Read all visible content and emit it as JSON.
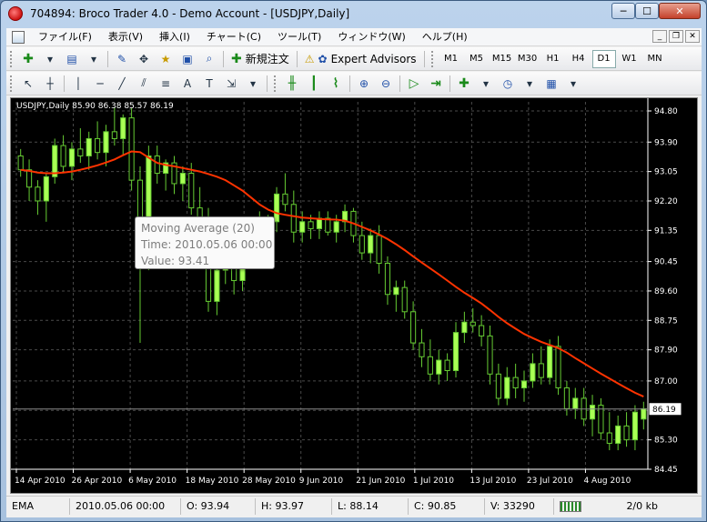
{
  "window": {
    "title": "704894: Broco Trader 4.0 - Demo Account - [USDJPY,Daily]",
    "controls": {
      "minimize": "─",
      "maximize": "☐",
      "close": "✕"
    }
  },
  "menu": [
    "ファイル(F)",
    "表示(V)",
    "挿入(I)",
    "チャート(C)",
    "ツール(T)",
    "ウィンドウ(W)",
    "ヘルプ(H)"
  ],
  "toolbar1": {
    "new_order": "新規注文",
    "expert_advisors": "Expert Advisors",
    "timeframes": [
      "M1",
      "M5",
      "M15",
      "M30",
      "H1",
      "H4",
      "D1",
      "W1",
      "MN"
    ],
    "active_timeframe": "D1"
  },
  "toolbar2": {
    "text_tool": "A",
    "label_tool": "T"
  },
  "chart": {
    "symbol_label": "USDJPY,Daily  85.90 86.38 85.57 86.19",
    "current_price": "86.19",
    "colors": {
      "background": "#000000",
      "grid": "#4a4a4a",
      "bull": "#aaff55",
      "bear": "#000000",
      "wick": "#66cc33",
      "ma": "#ff3300",
      "axis_text": "#ffffff"
    }
  },
  "chart_data": {
    "type": "candlestick",
    "y_ticks": [
      "94.80",
      "93.90",
      "93.05",
      "92.20",
      "91.35",
      "90.45",
      "89.60",
      "88.75",
      "87.90",
      "87.00",
      "86.15",
      "85.30",
      "84.45"
    ],
    "ylim": [
      84.45,
      94.8
    ],
    "x_labels": [
      "14 Apr 2010",
      "26 Apr 2010",
      "6 May 2010",
      "18 May 2010",
      "28 May 2010",
      "9 Jun 2010",
      "21 Jun 2010",
      "1 Jul 2010",
      "13 Jul 2010",
      "23 Jul 2010",
      "4 Aug 2010"
    ],
    "candles": [
      {
        "o": 93.5,
        "h": 93.7,
        "l": 92.9,
        "c": 93.1
      },
      {
        "o": 93.1,
        "h": 93.4,
        "l": 92.2,
        "c": 92.6
      },
      {
        "o": 92.6,
        "h": 92.8,
        "l": 91.8,
        "c": 92.2
      },
      {
        "o": 92.2,
        "h": 93.0,
        "l": 91.6,
        "c": 92.9
      },
      {
        "o": 92.9,
        "h": 94.0,
        "l": 92.7,
        "c": 93.8
      },
      {
        "o": 93.8,
        "h": 94.1,
        "l": 93.0,
        "c": 93.2
      },
      {
        "o": 93.2,
        "h": 93.9,
        "l": 92.8,
        "c": 93.7
      },
      {
        "o": 93.7,
        "h": 94.3,
        "l": 93.3,
        "c": 93.5
      },
      {
        "o": 93.5,
        "h": 94.2,
        "l": 93.1,
        "c": 94.0
      },
      {
        "o": 94.0,
        "h": 94.5,
        "l": 93.4,
        "c": 93.6
      },
      {
        "o": 93.6,
        "h": 94.4,
        "l": 93.2,
        "c": 94.2
      },
      {
        "o": 94.2,
        "h": 94.9,
        "l": 93.8,
        "c": 94.0
      },
      {
        "o": 94.0,
        "h": 94.7,
        "l": 93.5,
        "c": 94.6
      },
      {
        "o": 94.6,
        "h": 94.9,
        "l": 92.5,
        "c": 92.8
      },
      {
        "o": 92.8,
        "h": 93.2,
        "l": 88.1,
        "c": 90.8
      },
      {
        "o": 90.8,
        "h": 93.8,
        "l": 90.2,
        "c": 93.5
      },
      {
        "o": 93.5,
        "h": 93.8,
        "l": 92.7,
        "c": 93.0
      },
      {
        "o": 93.0,
        "h": 93.4,
        "l": 92.5,
        "c": 93.3
      },
      {
        "o": 93.3,
        "h": 93.5,
        "l": 92.4,
        "c": 92.7
      },
      {
        "o": 92.7,
        "h": 93.2,
        "l": 92.2,
        "c": 93.0
      },
      {
        "o": 93.0,
        "h": 93.3,
        "l": 91.8,
        "c": 92.0
      },
      {
        "o": 92.0,
        "h": 92.6,
        "l": 90.5,
        "c": 90.8
      },
      {
        "o": 90.8,
        "h": 92.0,
        "l": 89.0,
        "c": 89.3
      },
      {
        "o": 89.3,
        "h": 90.6,
        "l": 88.9,
        "c": 90.2
      },
      {
        "o": 90.2,
        "h": 91.1,
        "l": 89.8,
        "c": 90.9
      },
      {
        "o": 90.9,
        "h": 91.2,
        "l": 89.5,
        "c": 89.9
      },
      {
        "o": 89.9,
        "h": 90.9,
        "l": 89.6,
        "c": 90.6
      },
      {
        "o": 90.6,
        "h": 91.5,
        "l": 90.3,
        "c": 91.2
      },
      {
        "o": 91.2,
        "h": 91.9,
        "l": 90.8,
        "c": 91.1
      },
      {
        "o": 91.1,
        "h": 91.8,
        "l": 90.7,
        "c": 91.6
      },
      {
        "o": 91.6,
        "h": 92.6,
        "l": 91.3,
        "c": 92.4
      },
      {
        "o": 92.4,
        "h": 93.0,
        "l": 91.9,
        "c": 92.1
      },
      {
        "o": 92.1,
        "h": 92.5,
        "l": 91.0,
        "c": 91.3
      },
      {
        "o": 91.3,
        "h": 91.9,
        "l": 91.0,
        "c": 91.6
      },
      {
        "o": 91.6,
        "h": 91.8,
        "l": 91.1,
        "c": 91.4
      },
      {
        "o": 91.4,
        "h": 91.9,
        "l": 91.1,
        "c": 91.7
      },
      {
        "o": 91.7,
        "h": 91.9,
        "l": 91.2,
        "c": 91.3
      },
      {
        "o": 91.3,
        "h": 91.8,
        "l": 91.0,
        "c": 91.6
      },
      {
        "o": 91.6,
        "h": 92.1,
        "l": 91.3,
        "c": 91.9
      },
      {
        "o": 91.9,
        "h": 92.0,
        "l": 91.0,
        "c": 91.2
      },
      {
        "o": 91.2,
        "h": 91.6,
        "l": 90.5,
        "c": 90.7
      },
      {
        "o": 90.7,
        "h": 91.4,
        "l": 90.4,
        "c": 91.2
      },
      {
        "o": 91.2,
        "h": 91.5,
        "l": 90.1,
        "c": 90.4
      },
      {
        "o": 90.4,
        "h": 90.6,
        "l": 89.2,
        "c": 89.5
      },
      {
        "o": 89.5,
        "h": 89.9,
        "l": 89.0,
        "c": 89.7
      },
      {
        "o": 89.7,
        "h": 89.9,
        "l": 88.8,
        "c": 89.0
      },
      {
        "o": 89.0,
        "h": 89.3,
        "l": 87.9,
        "c": 88.1
      },
      {
        "o": 88.1,
        "h": 88.5,
        "l": 87.4,
        "c": 87.7
      },
      {
        "o": 87.7,
        "h": 88.2,
        "l": 87.0,
        "c": 87.2
      },
      {
        "o": 87.2,
        "h": 87.9,
        "l": 86.9,
        "c": 87.6
      },
      {
        "o": 87.6,
        "h": 87.8,
        "l": 87.0,
        "c": 87.3
      },
      {
        "o": 87.3,
        "h": 88.7,
        "l": 87.1,
        "c": 88.4
      },
      {
        "o": 88.4,
        "h": 89.0,
        "l": 88.1,
        "c": 88.7
      },
      {
        "o": 88.7,
        "h": 89.1,
        "l": 88.4,
        "c": 88.6
      },
      {
        "o": 88.6,
        "h": 88.9,
        "l": 88.0,
        "c": 88.3
      },
      {
        "o": 88.3,
        "h": 88.6,
        "l": 86.9,
        "c": 87.2
      },
      {
        "o": 87.2,
        "h": 87.5,
        "l": 86.3,
        "c": 86.5
      },
      {
        "o": 86.5,
        "h": 87.4,
        "l": 86.3,
        "c": 87.1
      },
      {
        "o": 87.1,
        "h": 87.5,
        "l": 86.5,
        "c": 86.8
      },
      {
        "o": 86.8,
        "h": 87.3,
        "l": 86.4,
        "c": 87.0
      },
      {
        "o": 87.0,
        "h": 87.8,
        "l": 86.8,
        "c": 87.5
      },
      {
        "o": 87.5,
        "h": 88.0,
        "l": 86.9,
        "c": 87.1
      },
      {
        "o": 87.1,
        "h": 88.2,
        "l": 86.9,
        "c": 88.0
      },
      {
        "o": 88.0,
        "h": 88.3,
        "l": 86.6,
        "c": 86.8
      },
      {
        "o": 86.8,
        "h": 87.0,
        "l": 86.0,
        "c": 86.2
      },
      {
        "o": 86.2,
        "h": 86.8,
        "l": 85.9,
        "c": 86.5
      },
      {
        "o": 86.5,
        "h": 86.8,
        "l": 85.7,
        "c": 85.9
      },
      {
        "o": 85.9,
        "h": 86.6,
        "l": 85.4,
        "c": 86.3
      },
      {
        "o": 86.3,
        "h": 86.5,
        "l": 85.3,
        "c": 85.5
      },
      {
        "o": 85.5,
        "h": 86.1,
        "l": 85.0,
        "c": 85.2
      },
      {
        "o": 85.2,
        "h": 86.0,
        "l": 85.0,
        "c": 85.7
      },
      {
        "o": 85.7,
        "h": 86.1,
        "l": 85.1,
        "c": 85.3
      },
      {
        "o": 85.3,
        "h": 86.3,
        "l": 85.0,
        "c": 86.1
      },
      {
        "o": 85.9,
        "h": 86.4,
        "l": 85.6,
        "c": 86.2
      }
    ],
    "ma_series": {
      "name": "Moving Average (20)",
      "values": [
        93.1,
        93.07,
        93.02,
        93.0,
        93.0,
        93.02,
        93.05,
        93.1,
        93.16,
        93.23,
        93.31,
        93.4,
        93.52,
        93.63,
        93.61,
        93.45,
        93.3,
        93.24,
        93.2,
        93.15,
        93.1,
        93.05,
        92.98,
        92.9,
        92.8,
        92.65,
        92.5,
        92.3,
        92.1,
        91.95,
        91.85,
        91.8,
        91.76,
        91.72,
        91.7,
        91.68,
        91.67,
        91.66,
        91.63,
        91.55,
        91.45,
        91.35,
        91.23,
        91.1,
        90.95,
        90.78,
        90.6,
        90.42,
        90.25,
        90.08,
        89.9,
        89.72,
        89.55,
        89.4,
        89.24,
        89.05,
        88.85,
        88.67,
        88.51,
        88.36,
        88.24,
        88.13,
        88.04,
        87.95,
        87.82,
        87.66,
        87.51,
        87.36,
        87.21,
        87.07,
        86.93,
        86.79,
        86.66,
        86.55
      ]
    }
  },
  "tooltip": {
    "title": "Moving Average (20)",
    "time": "Time: 2010.05.06 00:00",
    "value": "Value: 93.41"
  },
  "statusbar": {
    "indicator": "EMA",
    "datetime": "2010.05.06 00:00",
    "open": "O: 93.94",
    "high": "H: 93.97",
    "low": "L: 88.14",
    "close": "C: 90.85",
    "volume": "V: 33290",
    "traffic": "2/0 kb"
  }
}
